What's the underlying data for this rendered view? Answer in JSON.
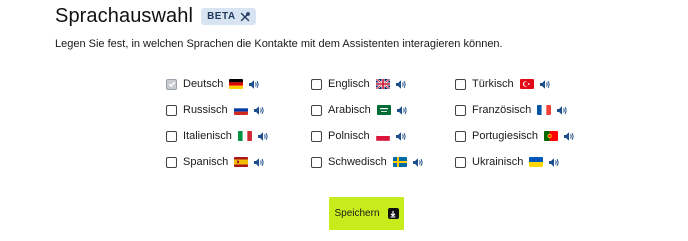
{
  "header": {
    "title": "Sprachauswahl",
    "badge": "BETA"
  },
  "description": "Legen Sie fest, in welchen Sprachen die Kontakte mit dem Assistenten interagieren können.",
  "languages": [
    {
      "label": "Deutsch",
      "checked": true,
      "flag": "de"
    },
    {
      "label": "Englisch",
      "checked": false,
      "flag": "gb"
    },
    {
      "label": "Türkisch",
      "checked": false,
      "flag": "tr"
    },
    {
      "label": "Russisch",
      "checked": false,
      "flag": "ru"
    },
    {
      "label": "Arabisch",
      "checked": false,
      "flag": "sa"
    },
    {
      "label": "Französisch",
      "checked": false,
      "flag": "fr"
    },
    {
      "label": "Italienisch",
      "checked": false,
      "flag": "it"
    },
    {
      "label": "Polnisch",
      "checked": false,
      "flag": "pl"
    },
    {
      "label": "Portugiesisch",
      "checked": false,
      "flag": "pt"
    },
    {
      "label": "Spanisch",
      "checked": false,
      "flag": "es"
    },
    {
      "label": "Schwedisch",
      "checked": false,
      "flag": "se"
    },
    {
      "label": "Ukrainisch",
      "checked": false,
      "flag": "ua"
    }
  ],
  "save_button": {
    "label": "Speichern"
  },
  "colors": {
    "accent": "#c7ec1c",
    "badge_bg": "#d9e4f3",
    "speaker": "#1f4e8c"
  }
}
